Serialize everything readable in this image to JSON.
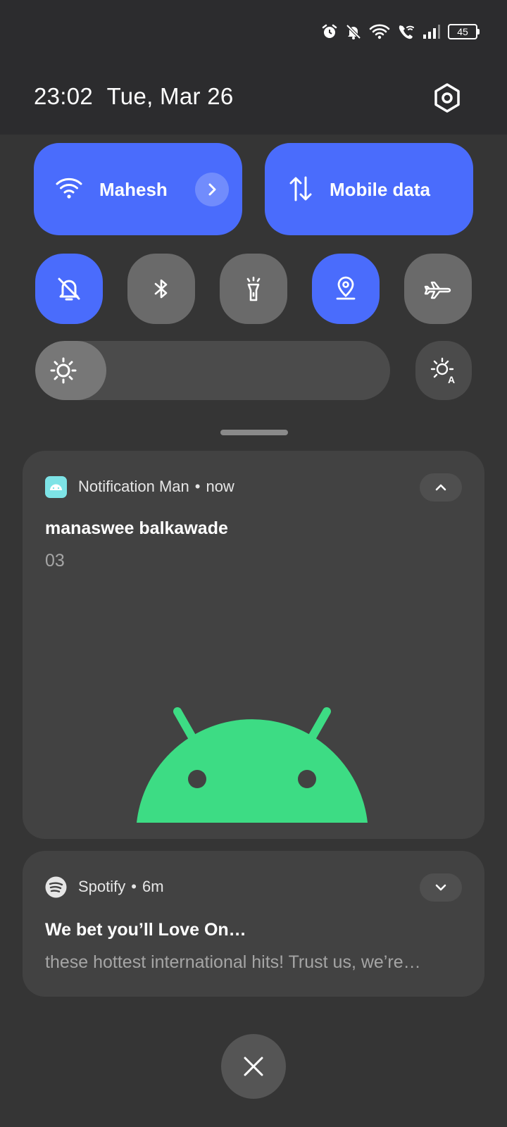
{
  "status_bar": {
    "battery_level": "45",
    "icons": [
      "alarm-icon",
      "muted-bell-icon",
      "wifi-icon",
      "wifi-calling-icon",
      "signal-icon",
      "battery-icon"
    ]
  },
  "header": {
    "time": "23:02",
    "date": "Tue, Mar 26"
  },
  "quick_settings": {
    "wifi": {
      "label": "Mahesh",
      "active": true
    },
    "mobile_data": {
      "label": "Mobile data",
      "active": true
    },
    "toggles": [
      {
        "name": "silent",
        "icon": "muted-bell-icon",
        "active": true
      },
      {
        "name": "bluetooth",
        "icon": "bluetooth-icon",
        "active": false
      },
      {
        "name": "flashlight",
        "icon": "flashlight-icon",
        "active": false
      },
      {
        "name": "location",
        "icon": "location-icon",
        "active": true
      },
      {
        "name": "airplane",
        "icon": "airplane-icon",
        "active": false
      }
    ],
    "brightness": {
      "level": 0.2,
      "auto_icon": "auto-brightness-icon"
    },
    "accent_color": "#4a6cfc"
  },
  "notifications": [
    {
      "app": "Notification Man",
      "time": "now",
      "title": "manaswee balkawade",
      "text": "03",
      "expanded": true,
      "image": "android-robot",
      "image_color": "#3ddc84"
    },
    {
      "app": "Spotify",
      "time": "6m",
      "title": "We bet you’ll Love On…",
      "text": "these hottest international hits! Trust us, we’re…",
      "expanded": false
    }
  ],
  "separator": "•"
}
